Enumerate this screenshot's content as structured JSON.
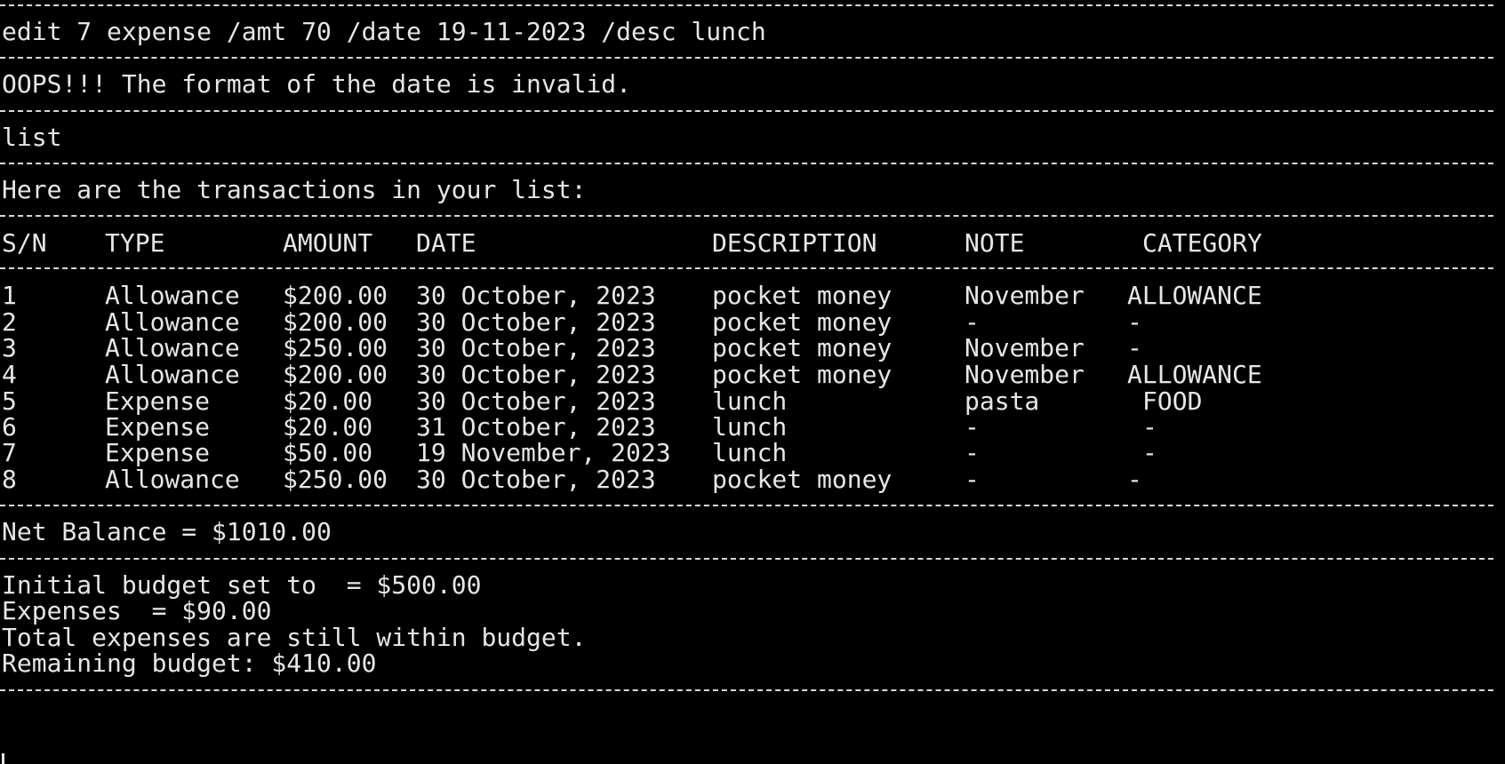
{
  "terminal": {
    "cmd_edit": "edit 7 expense /amt 70 /date 19-11-2023 /desc lunch",
    "error_msg": "OOPS!!! The format of the date is invalid.",
    "cmd_list": "list",
    "list_header": "Here are the transactions in your list:",
    "columns": [
      "S/N",
      "TYPE",
      "AMOUNT",
      "DATE",
      "DESCRIPTION",
      "NOTE",
      "CATEGORY"
    ],
    "rows": [
      {
        "sn": "1",
        "type": "Allowance",
        "amount": "$200.00",
        "date": "30 October, 2023",
        "desc": "pocket money",
        "note": "November",
        "category": "ALLOWANCE"
      },
      {
        "sn": "2",
        "type": "Allowance",
        "amount": "$200.00",
        "date": "30 October, 2023",
        "desc": "pocket money",
        "note": "-",
        "category": "-"
      },
      {
        "sn": "3",
        "type": "Allowance",
        "amount": "$250.00",
        "date": "30 October, 2023",
        "desc": "pocket money",
        "note": "November",
        "category": "-"
      },
      {
        "sn": "4",
        "type": "Allowance",
        "amount": "$200.00",
        "date": "30 October, 2023",
        "desc": "pocket money",
        "note": "November",
        "category": "ALLOWANCE"
      },
      {
        "sn": "5",
        "type": "Expense",
        "amount": "$20.00",
        "date": "30 October, 2023",
        "desc": "lunch",
        "note": "pasta",
        "category": "FOOD"
      },
      {
        "sn": "6",
        "type": "Expense",
        "amount": "$20.00",
        "date": "31 October, 2023",
        "desc": "lunch",
        "note": "-",
        "category": "-"
      },
      {
        "sn": "7",
        "type": "Expense",
        "amount": "$50.00",
        "date": "19 November, 2023",
        "desc": "lunch",
        "note": "-",
        "category": "-"
      },
      {
        "sn": "8",
        "type": "Allowance",
        "amount": "$250.00",
        "date": "30 October, 2023",
        "desc": "pocket money",
        "note": "-",
        "category": "-"
      }
    ],
    "net_balance": "Net Balance = $1010.00",
    "budget_initial": "Initial budget set to  = $500.00",
    "budget_expenses": "Expenses  = $90.00",
    "budget_status": "Total expenses are still within budget.",
    "budget_remaining": "Remaining budget: $410.00"
  },
  "colors": {
    "background": "#000000",
    "foreground": "#e6e6e6"
  }
}
